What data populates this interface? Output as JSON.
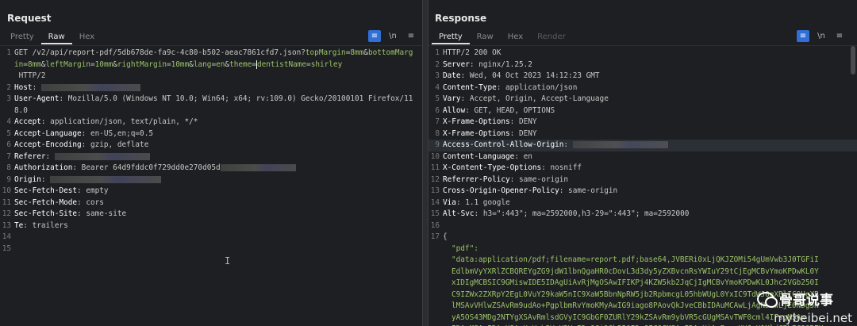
{
  "request": {
    "title": "Request",
    "tabs": [
      "Pretty",
      "Raw",
      "Hex"
    ],
    "active_tab": "Raw",
    "line1": {
      "method": "GET",
      "path": " /v2/api/report-pdf/5db678de-fa9c-4c80-b502-aeac7861cfd7.json?",
      "params": [
        {
          "k": "topMargin",
          "v": "8mm"
        },
        {
          "k": "bottomMargin",
          "v": "8mm"
        },
        {
          "k": "leftMargin",
          "v": "10mm"
        },
        {
          "k": "rightMargin",
          "v": "10mm"
        },
        {
          "k": "lang",
          "v": "en"
        },
        {
          "k": "theme",
          "v": ""
        },
        {
          "k": "dentistName",
          "v": "shirley"
        }
      ],
      "proto": " HTTP/2"
    },
    "headers": [
      {
        "n": 2,
        "key": "Host",
        "val": ""
      },
      {
        "n": 3,
        "key": "User-Agent",
        "val": "Mozilla/5.0 (Windows NT 10.0; Win64; x64; rv:109.0) Gecko/20100101 Firefox/118.0"
      },
      {
        "n": 4,
        "key": "Accept",
        "val": "application/json, text/plain, */*"
      },
      {
        "n": 5,
        "key": "Accept-Language",
        "val": "en-US,en;q=0.5"
      },
      {
        "n": 6,
        "key": "Accept-Encoding",
        "val": "gzip, deflate"
      },
      {
        "n": 7,
        "key": "Referer",
        "val": ""
      },
      {
        "n": 8,
        "key": "Authorization",
        "val": "Bearer 64d9fddc0f729dd0e270d05d"
      },
      {
        "n": 9,
        "key": "Origin",
        "val": ""
      },
      {
        "n": 10,
        "key": "Sec-Fetch-Dest",
        "val": "empty"
      },
      {
        "n": 11,
        "key": "Sec-Fetch-Mode",
        "val": "cors"
      },
      {
        "n": 12,
        "key": "Sec-Fetch-Site",
        "val": "same-site"
      },
      {
        "n": 13,
        "key": "Te",
        "val": "trailers"
      }
    ],
    "empty_lines": [
      14,
      15
    ]
  },
  "response": {
    "title": "Response",
    "tabs": [
      "Pretty",
      "Raw",
      "Hex",
      "Render"
    ],
    "active_tab": "Pretty",
    "status_line": "HTTP/2 200 OK",
    "headers": [
      {
        "n": 2,
        "key": "Server",
        "val": "nginx/1.25.2"
      },
      {
        "n": 3,
        "key": "Date",
        "val": "Wed, 04 Oct 2023 14:12:23 GMT"
      },
      {
        "n": 4,
        "key": "Content-Type",
        "val": "application/json"
      },
      {
        "n": 5,
        "key": "Vary",
        "val": "Accept, Origin, Accept-Language"
      },
      {
        "n": 6,
        "key": "Allow",
        "val": "GET, HEAD, OPTIONS"
      },
      {
        "n": 7,
        "key": "X-Frame-Options",
        "val": "DENY"
      },
      {
        "n": 8,
        "key": "X-Frame-Options",
        "val": "DENY"
      },
      {
        "n": 9,
        "key": "Access-Control-Allow-Origin",
        "val": ""
      },
      {
        "n": 10,
        "key": "Content-Language",
        "val": "en"
      },
      {
        "n": 11,
        "key": "X-Content-Type-Options",
        "val": "nosniff"
      },
      {
        "n": 12,
        "key": "Referrer-Policy",
        "val": "same-origin"
      },
      {
        "n": 13,
        "key": "Cross-Origin-Opener-Policy",
        "val": "same-origin"
      },
      {
        "n": 14,
        "key": "Via",
        "val": "1.1 google"
      },
      {
        "n": 15,
        "key": "Alt-Svc",
        "val": "h3=\":443\"; ma=2592000,h3-29=\":443\"; ma=2592000"
      }
    ],
    "body": {
      "open_brace": "{",
      "key": "\"pdf\":",
      "value_lines": [
        "\"data:application/pdf;filename=report.pdf;base64,JVBERi0xLjQKJZOMi54gUmVwb3J0TGFiI",
        "EdlbmVyYXRlZCBQREYgZG9jdW1lbnQgaHR0cDovL3d3dy5yZXBvcnRsYWIuY29tCjEgMCBvYmoKPDwKL0Y",
        "xIDIgMCBSIC9GMiswIDE5IDAgUiAvRjMgOSAwIFIKPj4KZW5kb2JqCjIgMCBvYmoKPDwKL0Jhc2VGb250I",
        "C9IZWx2ZXRpY2EgL0VuY29kaW5nIC9XaW5BbnNpRW5jb2RpbmcgL05hbWUgL0YxIC9TdWJ0eXBlIC9UeXB",
        "lMSAvVHlwZSAvRm9udAo+PgplbmRvYmoKMyAwIG9iago8PAovQkJveCBbIDAuMCAwLjAgNDEwLjE0NDg5N",
        "yA5OS43MDg2NTYgXSAvRmlsdGVyIC9GbGF0ZURlY29kZSAvRm9ybVR5cGUgMSAvTWF0cml4IFsgMSAw",
        "IDAgMSAwIDAgXSAvUmVzb3VyY2VzIDw8Ci9Gb250IDw8IC9GMSAyIDAgUiA+PgovUHJvY1NldCBbIC9QREY"
      ]
    }
  },
  "toolbar": {
    "wrap_icon": "≡",
    "newline_label": "\\n",
    "menu_icon": "≡"
  },
  "watermark": {
    "name": "骨哥说事",
    "site": "mybeibei.net"
  },
  "colors": {
    "background": "#1e1f22",
    "accent": "#2f6fd6",
    "string_green": "#9cc26a",
    "header_key": "#ffffff"
  }
}
